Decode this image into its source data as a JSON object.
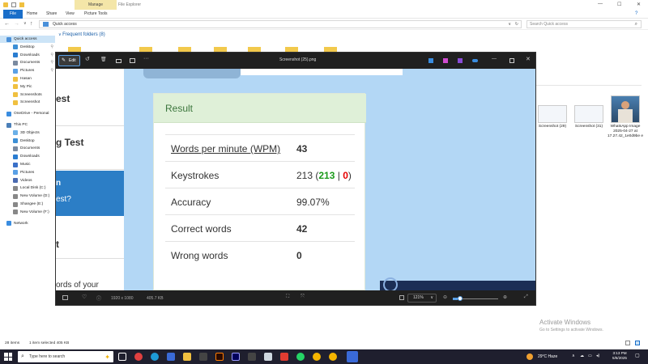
{
  "explorer": {
    "manage_tab": "Manage",
    "app_title": "File Explorer",
    "ribbon_tabs": [
      "File",
      "Home",
      "Share",
      "View",
      "Picture Tools"
    ],
    "address": "Quick access",
    "search_placeholder": "Search Quick access",
    "frequent_header": "Frequent folders (8)",
    "nav_items": [
      {
        "label": "Quick access",
        "indent": 0,
        "icon_color": "#4a90d9",
        "selected": true
      },
      {
        "label": "Desktop",
        "indent": 1,
        "icon_color": "#3c8fd6",
        "pinned": true
      },
      {
        "label": "Downloads",
        "indent": 1,
        "icon_color": "#2a7dd1",
        "pinned": true
      },
      {
        "label": "Documents",
        "indent": 1,
        "icon_color": "#7a8aa0",
        "pinned": true
      },
      {
        "label": "Pictures",
        "indent": 1,
        "icon_color": "#5aa0e6",
        "pinned": true
      },
      {
        "label": "Hasan",
        "indent": 1,
        "icon_color": "#f0c040"
      },
      {
        "label": "My Pic",
        "indent": 1,
        "icon_color": "#f0c040"
      },
      {
        "label": "Screenshots",
        "indent": 1,
        "icon_color": "#f0c040"
      },
      {
        "label": "Screenshot",
        "indent": 1,
        "icon_color": "#f0c040"
      },
      {
        "label": "OneDrive - Personal",
        "indent": 0,
        "icon_color": "#3a8de0"
      },
      {
        "label": "This PC",
        "indent": 0,
        "icon_color": "#4b7fb8"
      },
      {
        "label": "3D Objects",
        "indent": 1,
        "icon_color": "#6ab0e8"
      },
      {
        "label": "Desktop",
        "indent": 1,
        "icon_color": "#3c8fd6"
      },
      {
        "label": "Documents",
        "indent": 1,
        "icon_color": "#7a8aa0"
      },
      {
        "label": "Downloads",
        "indent": 1,
        "icon_color": "#2a7dd1"
      },
      {
        "label": "Music",
        "indent": 1,
        "icon_color": "#3a70c8"
      },
      {
        "label": "Pictures",
        "indent": 1,
        "icon_color": "#5aa0e6"
      },
      {
        "label": "Videos",
        "indent": 1,
        "icon_color": "#4a6ab0"
      },
      {
        "label": "Local Disk (C:)",
        "indent": 1,
        "icon_color": "#888"
      },
      {
        "label": "New Volume (D:)",
        "indent": 1,
        "icon_color": "#888"
      },
      {
        "label": "Shangee (E:)",
        "indent": 1,
        "icon_color": "#888"
      },
      {
        "label": "New Volume (F:)",
        "indent": 1,
        "icon_color": "#888"
      },
      {
        "label": "Network",
        "indent": 0,
        "icon_color": "#3a8de0"
      }
    ],
    "recent_files": [
      {
        "label": "Screenshot (29)"
      },
      {
        "label": "Screenshot (31)"
      },
      {
        "label": "WhatsApp Image 2025-04-27 at 17.27.42_1e0d9be e"
      }
    ],
    "status_items": "28 items",
    "status_selected": "1 item selected  405 KB",
    "watermark_title": "Activate Windows",
    "watermark_sub": "Go to Settings to activate Windows."
  },
  "viewer": {
    "edit_label": "Edit",
    "title": "Screenshot (25).png",
    "dimensions": "1920 x 1080",
    "file_size": "405.7 KB",
    "zoom": "121%"
  },
  "screenshot": {
    "left_texts": [
      "est",
      "g Test",
      "t",
      "ords of your"
    ],
    "blue_texts": [
      "n",
      "est?"
    ],
    "result_title": "Result",
    "rows": [
      {
        "label": "Words per minute (WPM)",
        "value": "43",
        "link": true
      },
      {
        "label": "Keystrokes",
        "value": "213",
        "correct": "213",
        "wrong": "0"
      },
      {
        "label": "Accuracy",
        "value": "99.07%"
      },
      {
        "label": "Correct words",
        "value": "42",
        "color": "green"
      },
      {
        "label": "Wrong words",
        "value": "0",
        "color": "red"
      }
    ]
  },
  "taskbar": {
    "search_placeholder": "Type here to search",
    "temperature": "29°C  Haze",
    "time": "3:13 PM",
    "date": "5/6/2025"
  }
}
